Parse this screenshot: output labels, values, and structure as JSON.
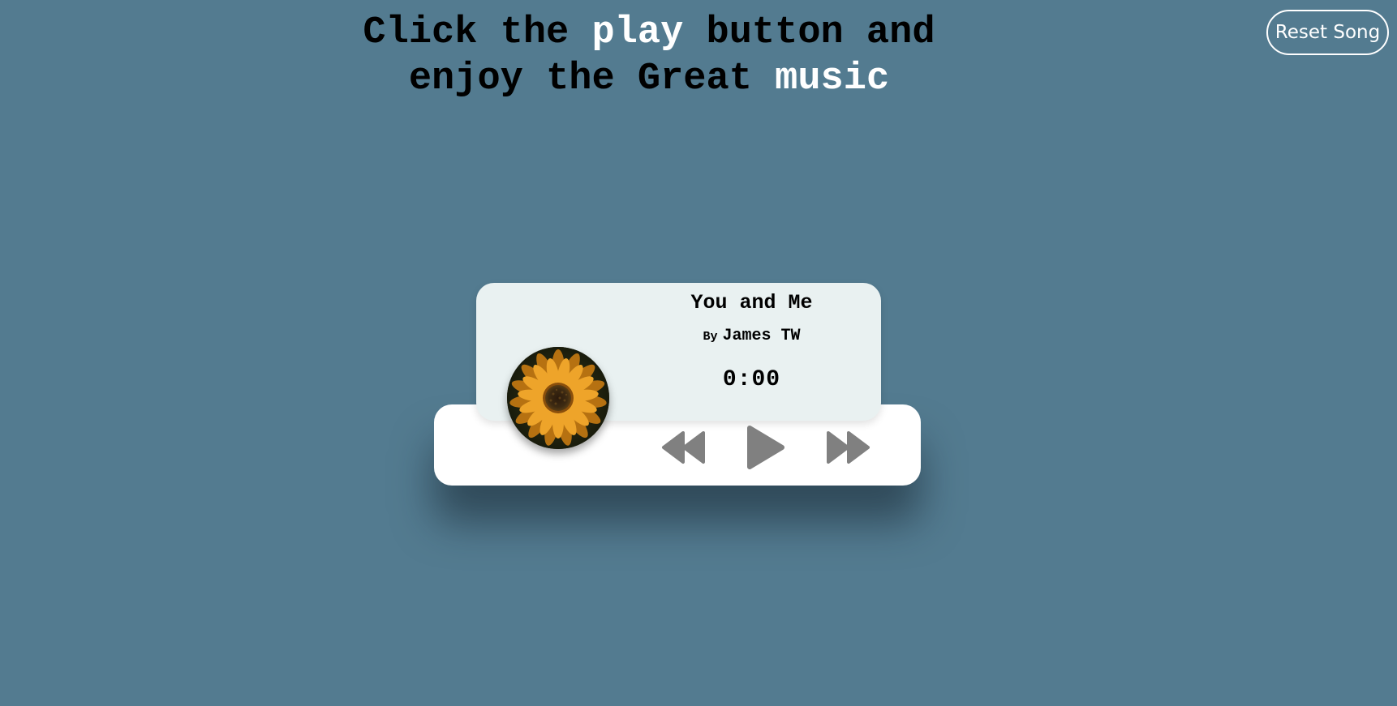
{
  "header": {
    "line1": {
      "part1": "Click the ",
      "highlight": "play",
      "part2": " button and"
    },
    "line2": {
      "part1": "enjoy the Great ",
      "highlight": "music"
    }
  },
  "reset_button": {
    "label": "Reset Song"
  },
  "player": {
    "title": "You and Me",
    "artist_prefix": "By",
    "artist": "James TW",
    "time": "0:00",
    "album_art": "sunflower-image",
    "controls": {
      "prev_icon": "rewind-icon",
      "play_icon": "play-icon",
      "next_icon": "fast-forward-icon"
    }
  },
  "colors": {
    "background": "#537b90",
    "card": "#e9f1f1",
    "control_bar": "#ffffff",
    "icon": "#808080",
    "highlight_text": "#ffffff"
  }
}
